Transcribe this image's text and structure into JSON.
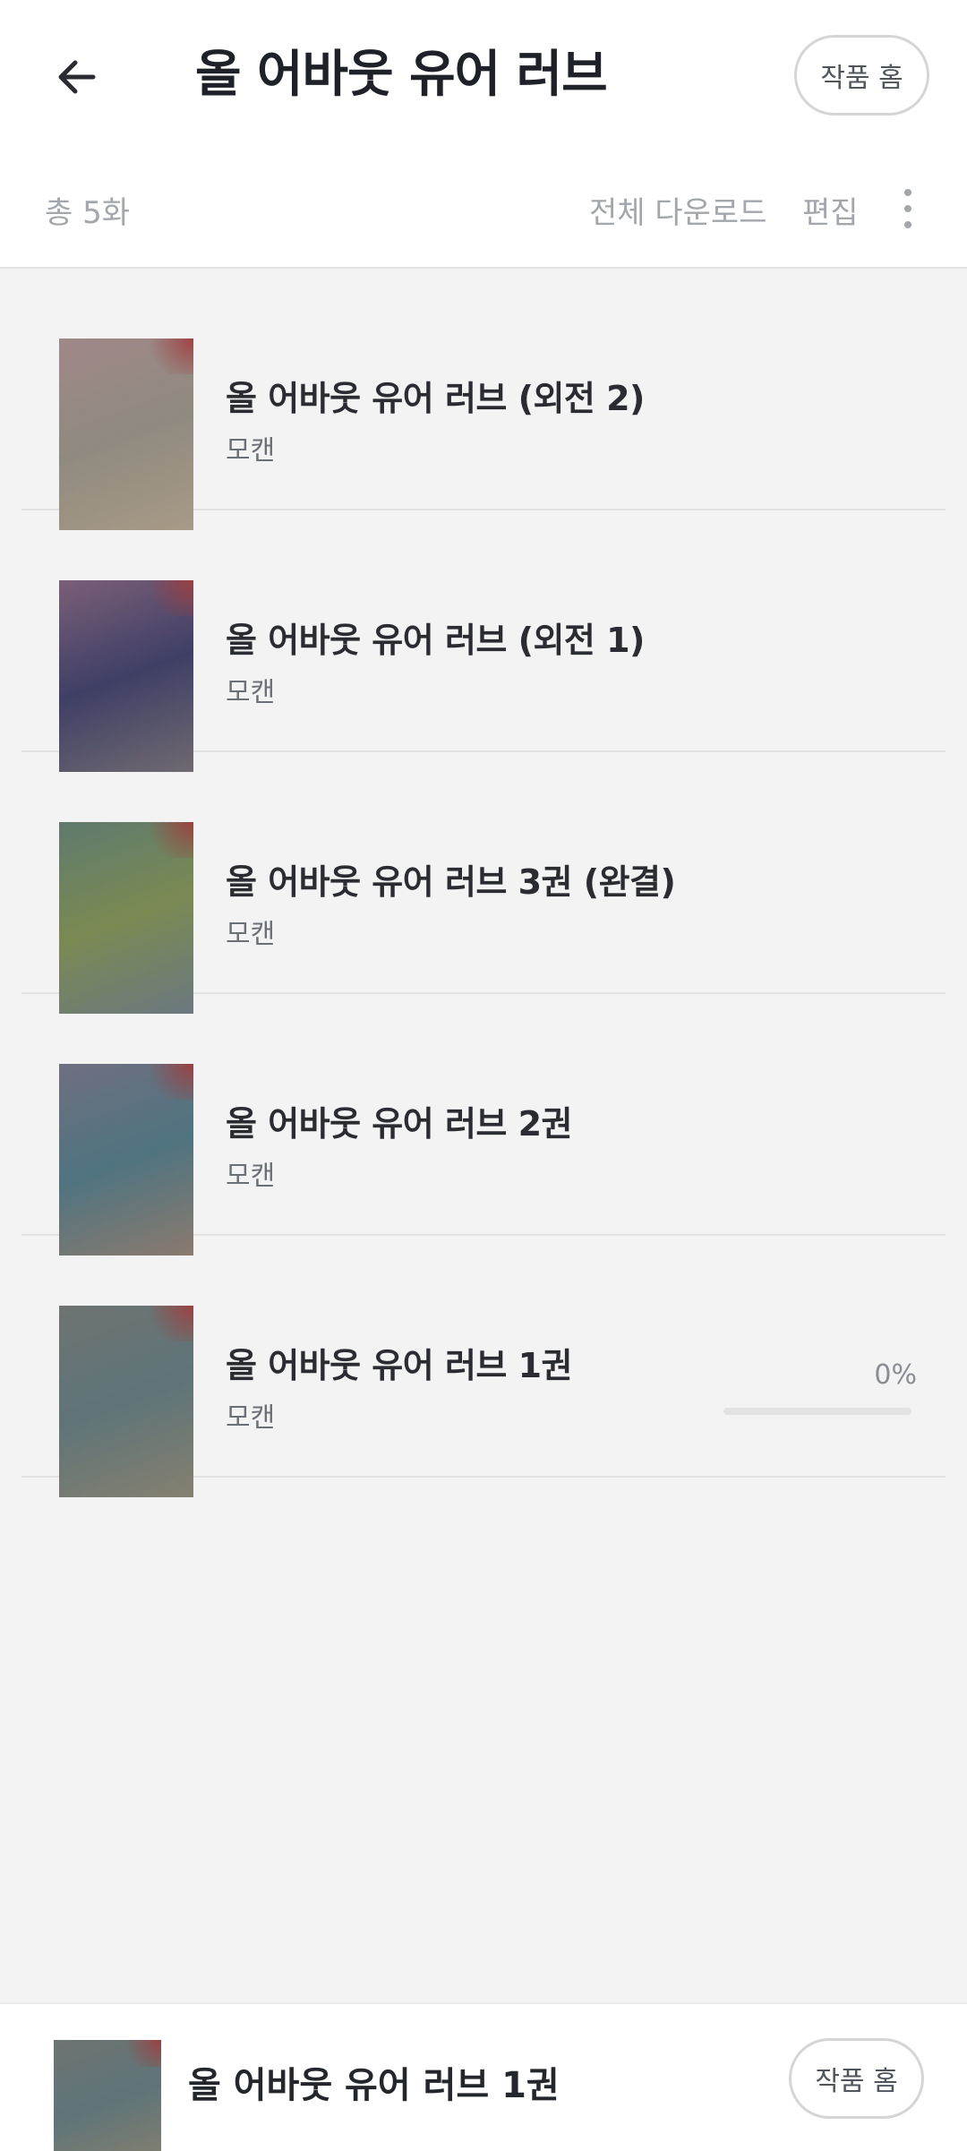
{
  "header": {
    "title": "올 어바웃 유어 러브",
    "work_home_label": "작품 홈",
    "back_icon": "arrow-left-icon"
  },
  "toolbar": {
    "total_count": "총 5화",
    "download_all_label": "전체 다운로드",
    "edit_label": "편집",
    "more_icon": "more-vertical-icon"
  },
  "episodes": [
    {
      "title": "올 어바웃 유어 러브 (외전 2)",
      "author": "모캔",
      "thumb_colors": [
        "#a08888",
        "#8f8a80",
        "#a89a86"
      ]
    },
    {
      "title": "올 어바웃 유어 러브 (외전 1)",
      "author": "모캔",
      "thumb_colors": [
        "#7a5f78",
        "#3f3f66",
        "#6f6a70"
      ]
    },
    {
      "title": "올 어바웃 유어 러브 3권 (완결)",
      "author": "모캔",
      "thumb_colors": [
        "#5f7a6e",
        "#7a8a52",
        "#6b7880"
      ]
    },
    {
      "title": "올 어바웃 유어 러브 2권",
      "author": "모캔",
      "thumb_colors": [
        "#6f6f80",
        "#4f7480",
        "#8a7a6e"
      ]
    },
    {
      "title": "올 어바웃 유어 러브 1권",
      "author": "모캔",
      "progress": "0%",
      "progress_value": 0,
      "thumb_colors": [
        "#6e7472",
        "#5f7478",
        "#85806f"
      ]
    }
  ],
  "bottom_bar": {
    "title": "올 어바웃 유어 러브 1권",
    "work_home_label": "작품 홈",
    "thumb_colors": [
      "#6e7472",
      "#5f7478",
      "#85806f"
    ]
  }
}
